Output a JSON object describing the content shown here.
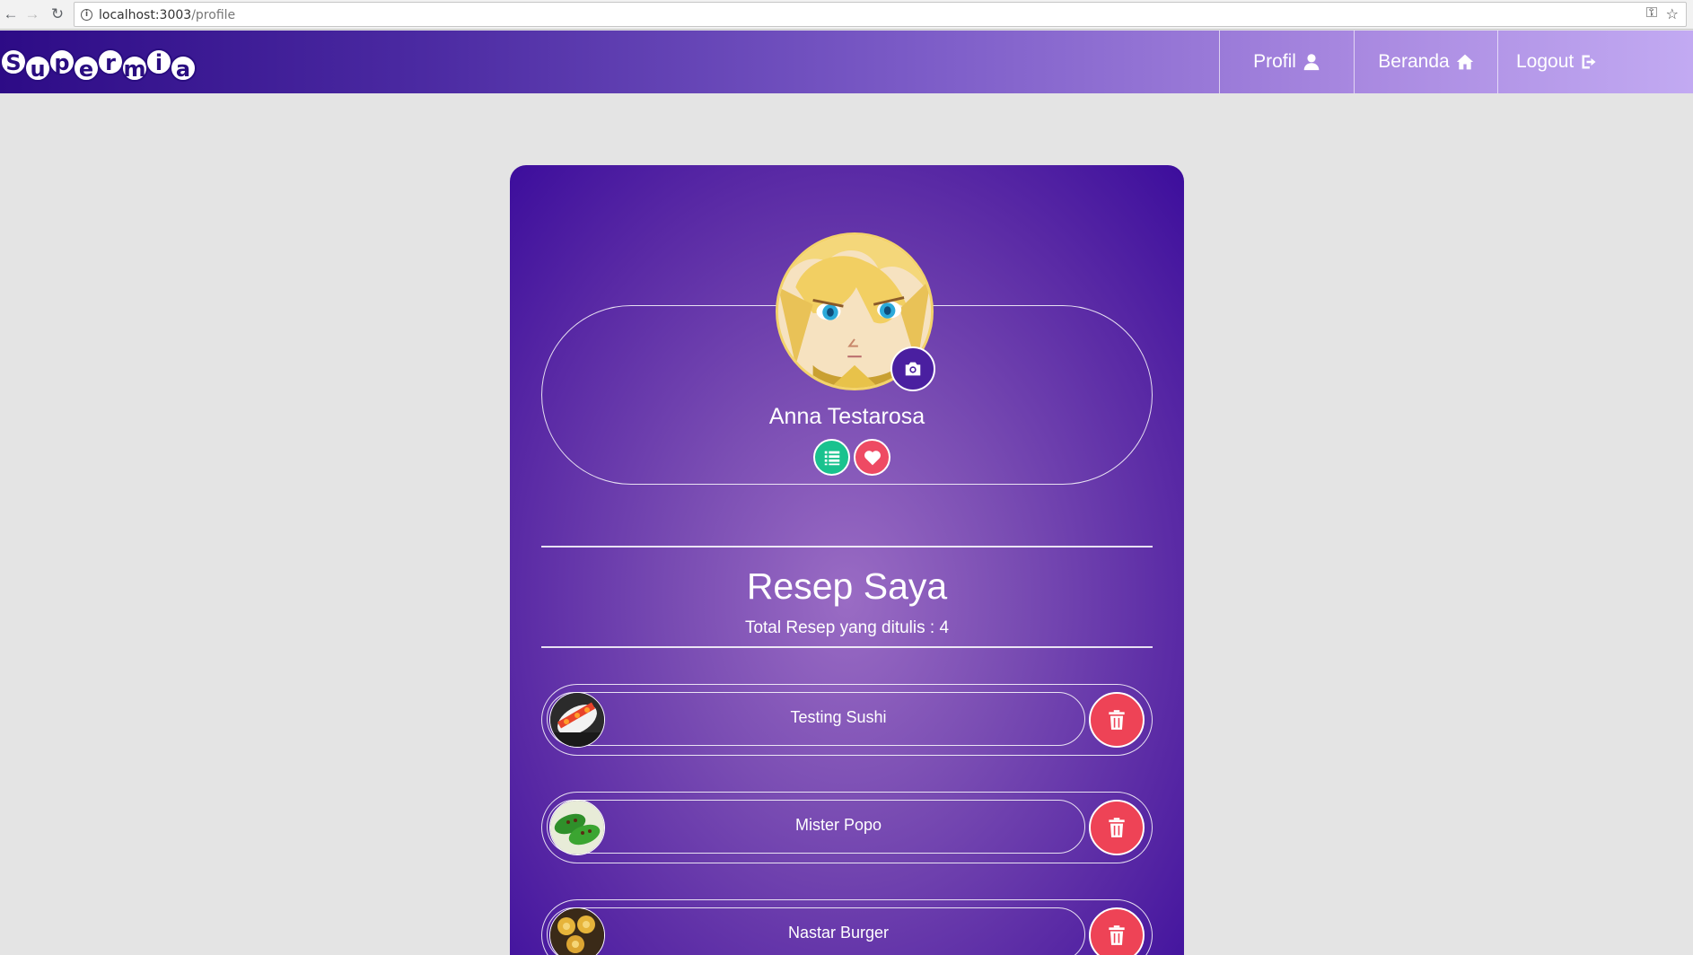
{
  "browser": {
    "url_host": "localhost:3003",
    "url_path": "/profile"
  },
  "navbar": {
    "logo_letters": [
      "S",
      "u",
      "p",
      "e",
      "r",
      "m",
      "i",
      "a"
    ],
    "links": [
      {
        "label": "Profil",
        "icon": "user-icon"
      },
      {
        "label": "Beranda",
        "icon": "home-icon"
      },
      {
        "label": "Logout",
        "icon": "logout-icon"
      }
    ]
  },
  "profile": {
    "name": "Anna Testarosa",
    "badges": [
      {
        "icon": "list-icon",
        "color": "#19c28e"
      },
      {
        "icon": "heart-icon",
        "color": "#ee4a63"
      }
    ]
  },
  "recipes_section": {
    "title": "Resep Saya",
    "subtitle": "Total Resep yang ditulis : 4",
    "items": [
      {
        "name": "Testing Sushi",
        "thumb": "sushi"
      },
      {
        "name": "Mister Popo",
        "thumb": "green-food"
      },
      {
        "name": "Nastar Burger",
        "thumb": "pastry"
      }
    ]
  },
  "colors": {
    "navbar_start": "#2d0b86",
    "navbar_end": "#c2aaf2",
    "card_purple": "#5a2aa5",
    "delete_red": "#ee4356",
    "page_bg": "#e4e4e4"
  }
}
